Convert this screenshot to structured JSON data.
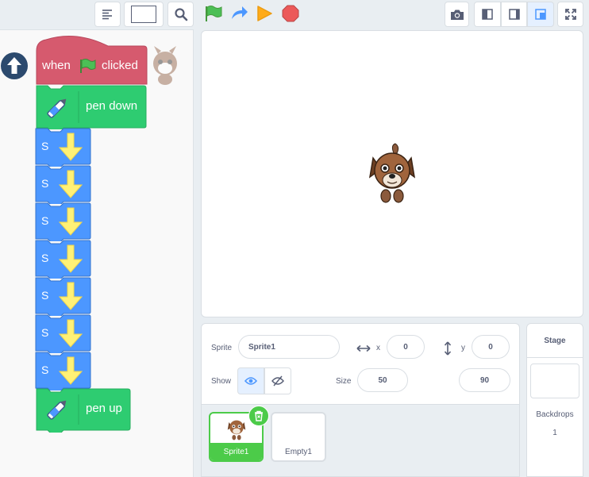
{
  "toolbar": {
    "menu_icon": "text-align-icon",
    "search_icon": "magnifier-icon",
    "green_flag_icon": "green-flag-icon",
    "turbo_icon": "turbo-arrow-icon",
    "run_icon": "orange-triangle-icon",
    "stop_icon": "stop-octagon-icon",
    "screenshot_icon": "camera-icon",
    "small_stage_icon": "small-stage-icon",
    "normal_stage_icon": "normal-stage-icon",
    "large_stage_icon": "large-stage-icon",
    "fullscreen_icon": "fullscreen-icon"
  },
  "script": {
    "hat_label_when": "when",
    "hat_label_clicked": "clicked",
    "pen_down_label": "pen down",
    "custom_block_label": "S",
    "custom_block_count": 7,
    "pen_up_label": "pen up",
    "colors": {
      "event": "#d65a6e",
      "pen": "#2ecc71",
      "custom": "#4c97ff",
      "arrow": "#fff176"
    }
  },
  "sprite_info": {
    "sprite_label": "Sprite",
    "sprite_name": "Sprite1",
    "x_label": "x",
    "x_value": "0",
    "y_label": "y",
    "y_value": "0",
    "show_label": "Show",
    "size_label": "Size",
    "size_value": "50",
    "direction_value": "90"
  },
  "sprites": [
    {
      "name": "Sprite1",
      "selected": true
    },
    {
      "name": "Empty1",
      "selected": false
    }
  ],
  "stage_panel": {
    "title": "Stage",
    "backdrops_label": "Backdrops",
    "backdrops_count": "1"
  }
}
